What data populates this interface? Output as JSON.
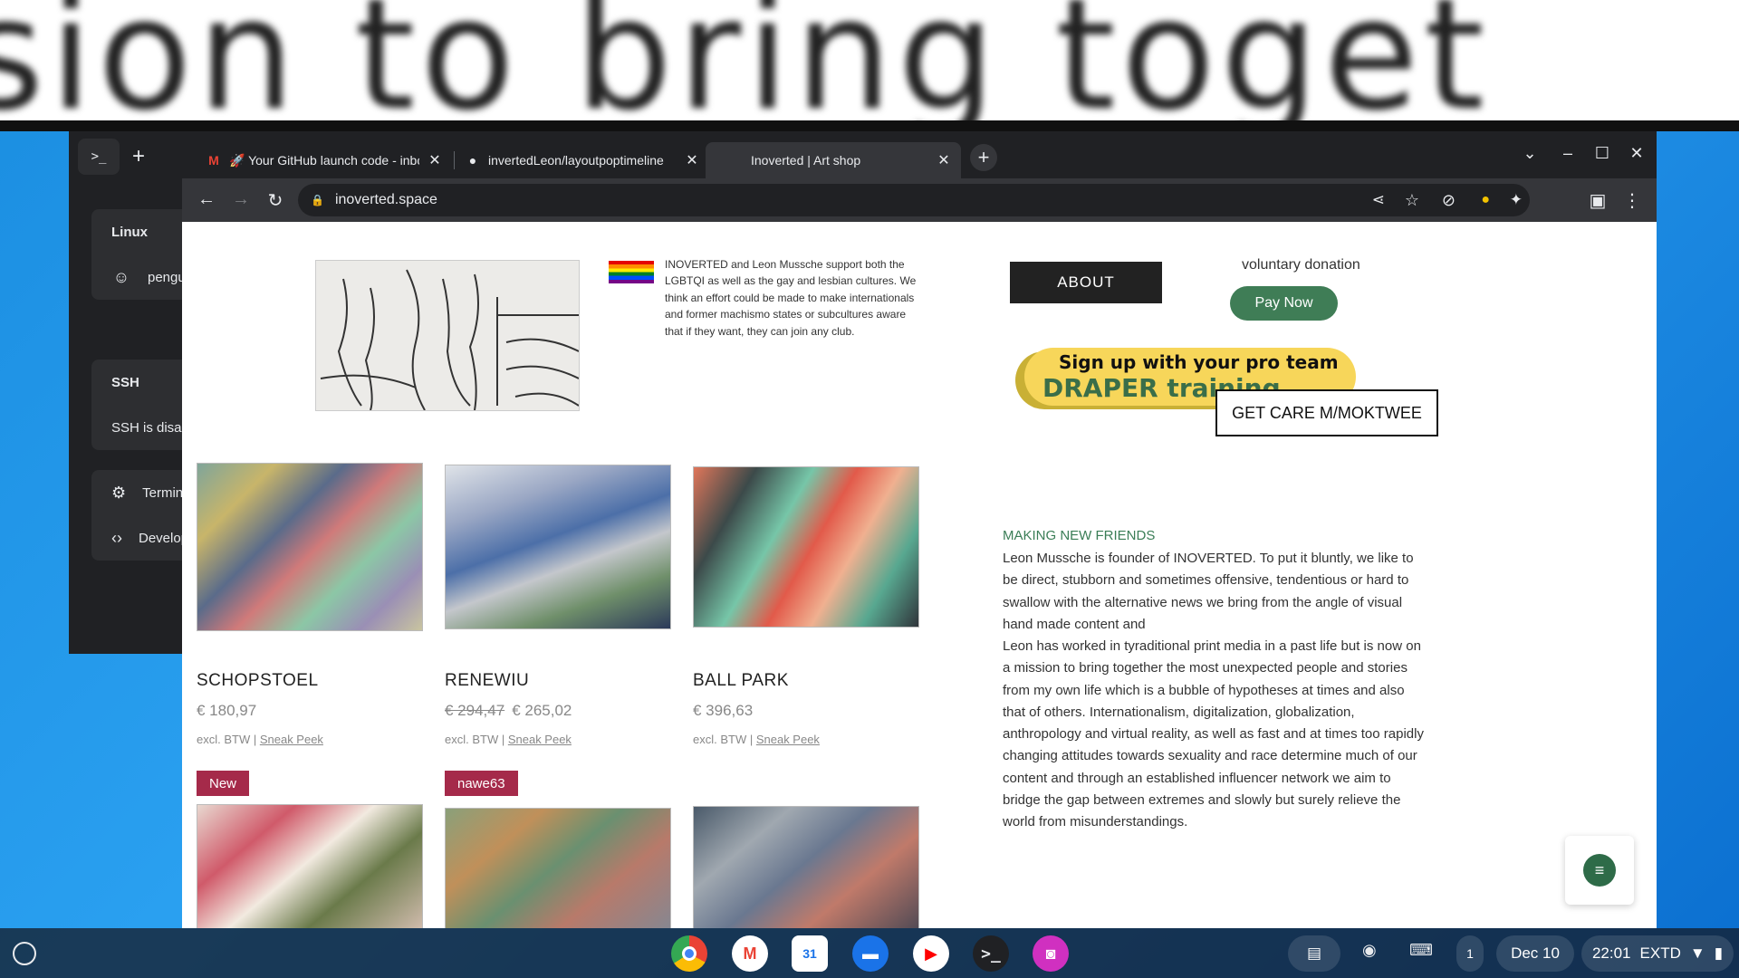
{
  "zoom_banner_text": "sion to bring toget",
  "terminal": {
    "linux_label": "Linux",
    "linux_item": "penguin",
    "ssh_label": "SSH",
    "ssh_item": "SSH is disabled",
    "settings_item": "Terminal settings",
    "developer_item": "Developer"
  },
  "browser": {
    "tabs": [
      {
        "title": "🚀 Your GitHub launch code - inbox",
        "favicon": "gmail-icon"
      },
      {
        "title": "invertedLeon/layoutpoptimeline",
        "favicon": "github-icon"
      },
      {
        "title": "Inoverted | Art shop",
        "favicon": "none"
      }
    ],
    "url": "inoverted.space"
  },
  "page": {
    "lgbt_text": "INOVERTED and Leon Mussche support both the LGBTQI as well as the gay and lesbian cultures. We think an effort could be made to make internationals and former machismo states or subcultures aware that if they want, they can join any club.",
    "about_label": "ABOUT",
    "donation_label": "voluntary donation",
    "pay_now_label": "Pay Now",
    "promo_line1": "Sign up with your pro team",
    "promo_line2": "DRAPER training",
    "care_label": "GET CARE M/MOKTWEE",
    "products": [
      {
        "name": "SCHOPSTOEL",
        "old_price": "",
        "price": "€ 180,97",
        "note": "excl. BTW | ",
        "link": "Sneak Peek"
      },
      {
        "name": "RENEWIU",
        "old_price": "€ 294,47",
        "price": "€ 265,02",
        "note": "excl. BTW | ",
        "link": "Sneak Peek"
      },
      {
        "name": "BALL PARK",
        "old_price": "",
        "price": "€ 396,63",
        "note": "excl. BTW | ",
        "link": "Sneak Peek"
      }
    ],
    "ribbons": [
      "New",
      "nawe63"
    ],
    "section_title": "MAKING NEW FRIENDS",
    "para1": "Leon Mussche is founder of INOVERTED. To put it bluntly, we like to be direct, stubborn and sometimes offensive, tendentious or hard to swallow with the alternative news we bring from the angle of visual hand made content and",
    "para2": "Leon has worked in tyraditional print media in a past life but is now on a mission to bring together the most unexpected people and stories from my own life which is a bubble of hypotheses at times and also that of others. Internationalism, digitalization, globalization, anthropology and virtual reality, as well as fast and at times too rapidly changing attitudes towards sexuality and race determine much of our content and through an established influencer network we aim to bridge the gap between extremes and slowly but surely relieve the world from misunderstandings."
  },
  "shelf": {
    "apps": [
      "chrome-icon",
      "gmail-icon",
      "calendar-icon",
      "files-icon",
      "youtube-icon",
      "terminal-icon",
      "screenshot-icon"
    ],
    "calendar_day": "31",
    "notification_count": "1",
    "date": "Dec 10",
    "time": "22:01",
    "keyboard_layout": "EXTD"
  }
}
